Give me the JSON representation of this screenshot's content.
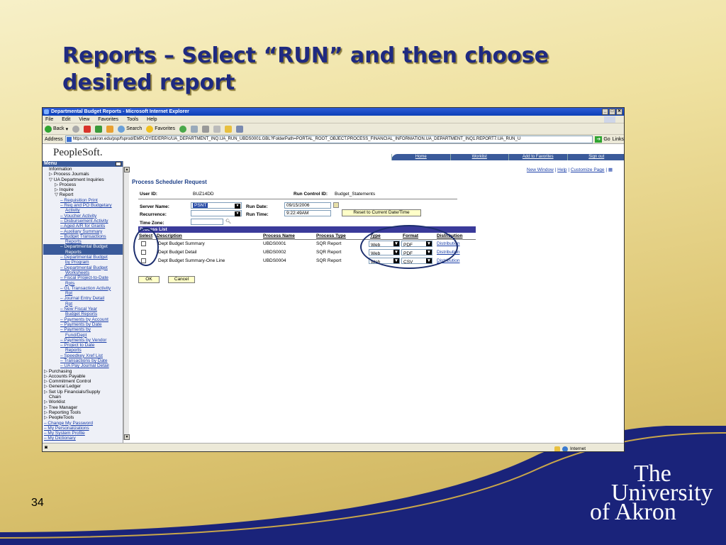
{
  "slide": {
    "title": "Reports – Select “RUN” and then choose desired report",
    "number": "34",
    "logo": {
      "line1": "The",
      "line2": "University",
      "line3": "of Akron"
    }
  },
  "browser": {
    "title": "Departmental Budget Reports - Microsoft Internet Explorer",
    "menus": [
      "File",
      "Edit",
      "View",
      "Favorites",
      "Tools",
      "Help"
    ],
    "toolbar": {
      "back": "Back",
      "search": "Search",
      "favorites": "Favorites"
    },
    "address_label": "Address",
    "address": "https://fs.uakron.edu/psp/fsprod/EMPLOYEE/ERP/c/UA_DEPARTMENT_INQ.UA_RUN_UBDS0001.GBL?FolderPath=PORTAL_ROOT_OBJECT.PROCESS_FINANCIAL_INFORMATION.UA_DEPARTMENT_INQ1.REPORT7.UA_RUN_U",
    "go": "Go",
    "links": "Links",
    "status_zone": "Internet"
  },
  "ps": {
    "logo": "PeopleSoft.",
    "nav": [
      "Home",
      "Worklist",
      "Add to Favorites",
      "Sign out"
    ],
    "menu_title": "Menu",
    "menu_items": [
      {
        "t": "Information",
        "i": 8,
        "k": "n"
      },
      {
        "t": "▷ Process Journals",
        "i": 8,
        "k": "n"
      },
      {
        "t": "▽ UA Department Inquiries",
        "i": 8,
        "k": "n"
      },
      {
        "t": "▷ Process",
        "i": 16,
        "k": "n"
      },
      {
        "t": "▷ Inquire",
        "i": 16,
        "k": "n"
      },
      {
        "t": "▽ Report",
        "i": 16,
        "k": "n"
      },
      {
        "t": "– Requisition Print",
        "i": 24,
        "k": "l"
      },
      {
        "t": "– Req and PO Budgetary",
        "i": 24,
        "k": "l"
      },
      {
        "t": "Activity",
        "i": 31,
        "k": "l"
      },
      {
        "t": "– Voucher Activity",
        "i": 24,
        "k": "l"
      },
      {
        "t": "– Disbursement Activity",
        "i": 24,
        "k": "l"
      },
      {
        "t": "– Aged A/R for Grants",
        "i": 24,
        "k": "l"
      },
      {
        "t": "– Auxiliary Summary",
        "i": 24,
        "k": "l"
      },
      {
        "t": "– Budget Transactions",
        "i": 24,
        "k": "l"
      },
      {
        "t": "Reports",
        "i": 31,
        "k": "l"
      },
      {
        "t": "– Departmental Budget",
        "i": 24,
        "k": "s"
      },
      {
        "t": "Reports",
        "i": 31,
        "k": "s"
      },
      {
        "t": "– Departmental Budget",
        "i": 24,
        "k": "l"
      },
      {
        "t": "by Program",
        "i": 31,
        "k": "l"
      },
      {
        "t": "– Departmental Budget",
        "i": 24,
        "k": "l"
      },
      {
        "t": "Worksheets",
        "i": 31,
        "k": "l"
      },
      {
        "t": "– Fiscal Project-to-Date",
        "i": 24,
        "k": "l"
      },
      {
        "t": "Rpts",
        "i": 31,
        "k": "l"
      },
      {
        "t": "– GL Transaction Activity",
        "i": 24,
        "k": "l"
      },
      {
        "t": "Rpt",
        "i": 31,
        "k": "l"
      },
      {
        "t": "– Journal Entry Detail",
        "i": 24,
        "k": "l"
      },
      {
        "t": "Rpt",
        "i": 31,
        "k": "l"
      },
      {
        "t": "– New Fiscal Year",
        "i": 24,
        "k": "l"
      },
      {
        "t": "Budget Reports",
        "i": 31,
        "k": "l"
      },
      {
        "t": "– Payments by Account",
        "i": 24,
        "k": "l"
      },
      {
        "t": "– Payments by Date",
        "i": 24,
        "k": "l"
      },
      {
        "t": "– Payments by",
        "i": 24,
        "k": "l"
      },
      {
        "t": "Fund/Dept",
        "i": 31,
        "k": "l"
      },
      {
        "t": "– Payments by Vendor",
        "i": 24,
        "k": "l"
      },
      {
        "t": "– Project to Date",
        "i": 24,
        "k": "l"
      },
      {
        "t": "Reports",
        "i": 31,
        "k": "l"
      },
      {
        "t": "– Speedkey Xref List",
        "i": 24,
        "k": "l"
      },
      {
        "t": "– Transactions by Date",
        "i": 24,
        "k": "l"
      },
      {
        "t": "– UA Pay Journal Detail",
        "i": 24,
        "k": "l"
      },
      {
        "t": "▷ Purchasing",
        "i": 1,
        "k": "n"
      },
      {
        "t": "▷ Accounts Payable",
        "i": 1,
        "k": "n"
      },
      {
        "t": "▷ Commitment Control",
        "i": 1,
        "k": "n"
      },
      {
        "t": "▷ General Ledger",
        "i": 1,
        "k": "n"
      },
      {
        "t": "▷ Set Up Financials/Supply",
        "i": 1,
        "k": "n"
      },
      {
        "t": "Chain",
        "i": 8,
        "k": "n"
      },
      {
        "t": "▷ Worklist",
        "i": 1,
        "k": "n"
      },
      {
        "t": "▷ Tree Manager",
        "i": 1,
        "k": "n"
      },
      {
        "t": "▷ Reporting Tools",
        "i": 1,
        "k": "n"
      },
      {
        "t": "▷ PeopleTools",
        "i": 1,
        "k": "n"
      },
      {
        "t": "– Change My Password",
        "i": 1,
        "k": "l"
      },
      {
        "t": "– My Personalizations",
        "i": 1,
        "k": "l"
      },
      {
        "t": "– My System Profile",
        "i": 1,
        "k": "l"
      },
      {
        "t": "– My Dictionary",
        "i": 1,
        "k": "l"
      }
    ],
    "top_links": {
      "new_window": "New Window",
      "help": "Help",
      "customize": "Customize Page"
    },
    "page_title": "Process Scheduler Request",
    "user_id_label": "User ID:",
    "user_id": "BUZ14DD",
    "run_control_label": "Run Control ID:",
    "run_control": "Budget_Statements",
    "server_label": "Server Name:",
    "server": "PSNT",
    "run_date_label": "Run Date:",
    "run_date": "09/15/2006",
    "recurrence_label": "Recurrence:",
    "run_time_label": "Run Time:",
    "run_time": "9:22:49AM",
    "reset_btn": "Reset to Current Date/Time",
    "timezone_label": "Time Zone:",
    "process_list_title": "Process List",
    "headers": {
      "select": "Select",
      "desc": "Description",
      "name": "Process Name",
      "ptype": "Process Type",
      "type": "Type",
      "format": "Format",
      "dist": "Distribution"
    },
    "rows": [
      {
        "desc": "Dept Budget Summary",
        "name": "UBDS0001",
        "ptype": "SQR Report",
        "type": "Web",
        "format": "PDF",
        "dist": "Distribution"
      },
      {
        "desc": "Dept Budget Detail",
        "name": "UBDS0002",
        "ptype": "SQR Report",
        "type": "Web",
        "format": "PDF",
        "dist": "Distribution"
      },
      {
        "desc": "Dept Budget Summary-One Line",
        "name": "UBDS0004",
        "ptype": "SQR Report",
        "type": "Web",
        "format": "CSV",
        "dist": "Distribution"
      }
    ],
    "ok": "OK",
    "cancel": "Cancel"
  }
}
